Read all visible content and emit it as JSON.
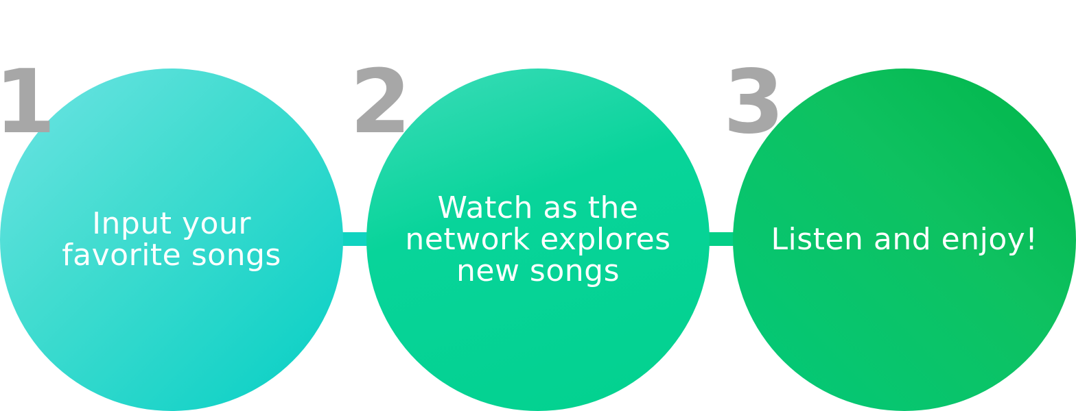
{
  "steps": [
    {
      "number": "1",
      "lines": [
        "Input your",
        "favorite songs"
      ]
    },
    {
      "number": "2",
      "lines": [
        "Watch as the",
        "network explores",
        "new songs"
      ]
    },
    {
      "number": "3",
      "lines": [
        "Listen and enjoy!"
      ]
    }
  ],
  "colors": {
    "number": "#a7a7a7",
    "text": "#ffffff",
    "circle1": "#42dcd0",
    "circle2": "#08d49a",
    "circle3": "#0ec160",
    "connector1": "#10d3c0",
    "connector2": "#04ce86"
  }
}
